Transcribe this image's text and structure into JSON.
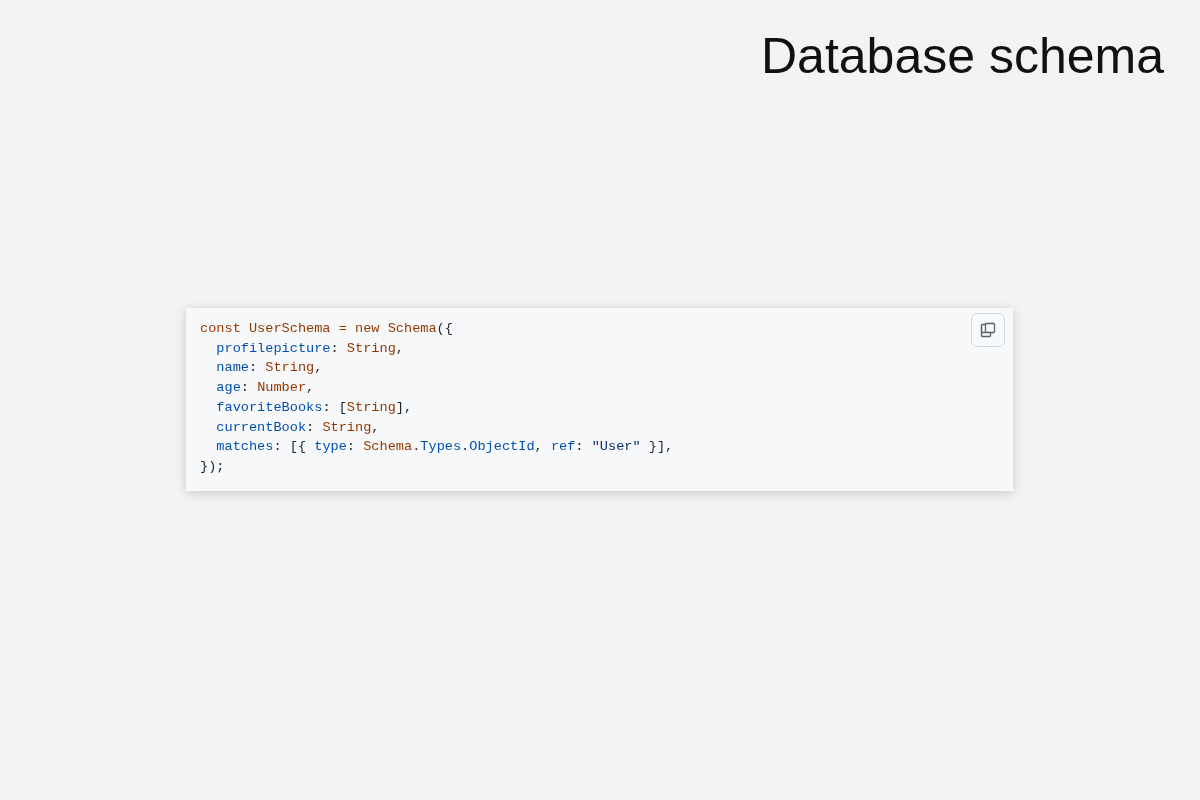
{
  "title": "Database schema",
  "code_block": {
    "lines": [
      {
        "tokens": [
          {
            "kind": "keyword",
            "text": "const "
          },
          {
            "kind": "name",
            "text": "UserSchema"
          },
          {
            "kind": "keyword",
            "text": " = "
          },
          {
            "kind": "keyword",
            "text": "new "
          },
          {
            "kind": "name",
            "text": "Schema"
          },
          {
            "kind": "punct",
            "text": "({"
          }
        ]
      },
      {
        "tokens": [
          {
            "kind": "prop",
            "text": "  profilepicture"
          },
          {
            "kind": "punct",
            "text": ": "
          },
          {
            "kind": "name",
            "text": "String"
          },
          {
            "kind": "punct",
            "text": ","
          }
        ]
      },
      {
        "tokens": [
          {
            "kind": "prop",
            "text": "  name"
          },
          {
            "kind": "punct",
            "text": ": "
          },
          {
            "kind": "name",
            "text": "String"
          },
          {
            "kind": "punct",
            "text": ","
          }
        ]
      },
      {
        "tokens": [
          {
            "kind": "prop",
            "text": "  age"
          },
          {
            "kind": "punct",
            "text": ": "
          },
          {
            "kind": "name",
            "text": "Number"
          },
          {
            "kind": "punct",
            "text": ","
          }
        ]
      },
      {
        "tokens": [
          {
            "kind": "prop",
            "text": "  favoriteBooks"
          },
          {
            "kind": "punct",
            "text": ": ["
          },
          {
            "kind": "name",
            "text": "String"
          },
          {
            "kind": "punct",
            "text": "],"
          }
        ]
      },
      {
        "tokens": [
          {
            "kind": "prop",
            "text": "  currentBook"
          },
          {
            "kind": "punct",
            "text": ": "
          },
          {
            "kind": "name",
            "text": "String"
          },
          {
            "kind": "punct",
            "text": ","
          }
        ]
      },
      {
        "tokens": [
          {
            "kind": "prop",
            "text": "  matches"
          },
          {
            "kind": "punct",
            "text": ": [{ "
          },
          {
            "kind": "prop",
            "text": "type"
          },
          {
            "kind": "punct",
            "text": ": "
          },
          {
            "kind": "name",
            "text": "Schema"
          },
          {
            "kind": "punct",
            "text": "."
          },
          {
            "kind": "prop",
            "text": "Types"
          },
          {
            "kind": "punct",
            "text": "."
          },
          {
            "kind": "prop",
            "text": "ObjectId"
          },
          {
            "kind": "punct",
            "text": ", "
          },
          {
            "kind": "prop",
            "text": "ref"
          },
          {
            "kind": "punct",
            "text": ": "
          },
          {
            "kind": "string",
            "text": "\"User\""
          },
          {
            "kind": "punct",
            "text": " }],"
          }
        ]
      },
      {
        "tokens": [
          {
            "kind": "punct",
            "text": "});"
          }
        ]
      }
    ]
  }
}
